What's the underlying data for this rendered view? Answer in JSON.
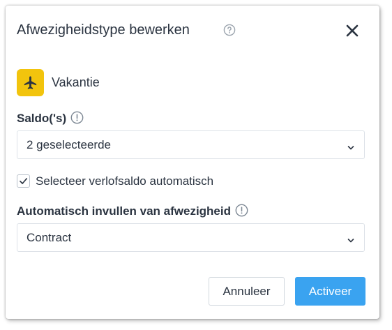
{
  "dialog": {
    "title": "Afwezigheidstype bewerken",
    "absence_type": {
      "name": "Vakantie",
      "icon": "airplane-icon",
      "badge_color": "#f2c40d"
    },
    "balances": {
      "label": "Saldo('s)",
      "value": "2 geselecteerde"
    },
    "auto_select": {
      "label": "Selecteer verlofsaldo automatisch",
      "checked": true
    },
    "auto_fill": {
      "label": "Automatisch invullen van afwezigheid",
      "value": "Contract"
    },
    "buttons": {
      "cancel": "Annuleer",
      "activate": "Activeer"
    },
    "colors": {
      "primary": "#3aa3f0",
      "text": "#2b3441"
    }
  }
}
